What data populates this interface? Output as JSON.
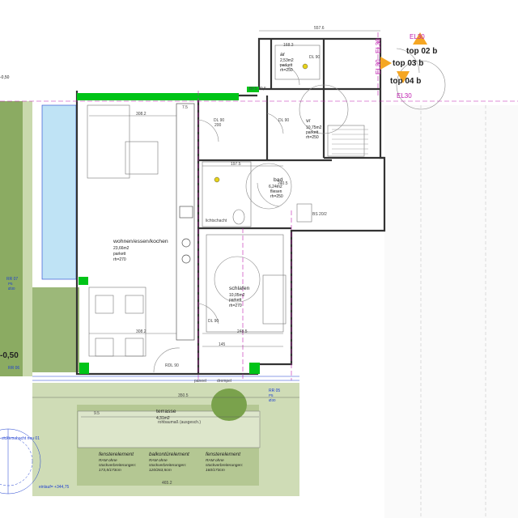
{
  "rooms": [
    {
      "name": "wohnen/essen/kochen",
      "area": "23,66m2",
      "floor": "parkett",
      "height": "rh=270"
    },
    {
      "name": "schlafen",
      "area": "10,05m2",
      "floor": "parkett",
      "height": "rh=270"
    },
    {
      "name": "bad",
      "area": "6,24m2",
      "floor": "fliesen",
      "height": "rh=250"
    },
    {
      "name": "vr",
      "area": "10,75m2",
      "floor": "parkett",
      "height": "rh=250"
    },
    {
      "name": "ar",
      "area": "2,53m2",
      "floor": "parkett",
      "height": "rh=250"
    },
    {
      "name": "terrasse",
      "area": "4,31m2",
      "floor": "",
      "height": ""
    }
  ],
  "unit_refs": [
    "top 02 b",
    "top 03 b",
    "top 04 b"
  ],
  "el_tags": [
    "EL30",
    "EL30",
    "EL30",
    "EL30"
  ],
  "level_marks": [
    "-0,50",
    "-0,50"
  ],
  "bottom_elements": [
    {
      "title": "fensterelement",
      "l1": "RAM ohne",
      "l2": "stockverbreiterungen:",
      "l3": "173,5/173cm"
    },
    {
      "title": "balkontürelement",
      "l1": "RAM ohne",
      "l2": "stockverbreiterungen:",
      "l3": "120/263,5cm"
    },
    {
      "title": "fensterelement",
      "l1": "RAM ohne",
      "l2": "stockverbreiterungen:",
      "l3": "160/173cm"
    }
  ],
  "left_notes": {
    "rr07": "RR 07",
    "rr06": "RR 06",
    "p5": "P5",
    "d30": "Ø30",
    "sickerschacht": "sickerschacht neu 01",
    "einlauf": "einlauf= +344,75"
  },
  "right_notes": {
    "rr05": "RR 05",
    "p5": "P5",
    "d30": "Ø30"
  },
  "dimensions": {
    "d557": "557.6",
    "d308a": "308.2",
    "d308b": "308.2",
    "d248": "248.5",
    "d197": "197.5",
    "d145": "145",
    "d465": "465.2",
    "d350": "350.5",
    "d380": "380.1",
    "d240": "240.5",
    "d168": "168.3",
    "d75": "7.5",
    "d95": "9.5"
  },
  "door_marks": {
    "dl1": "DL 90",
    "dl2": "DL 90",
    "dl3": "DL 90",
    "dl4": "DL 90",
    "h200": "200",
    "rdl": "RDL 90"
  },
  "labels": {
    "paneel": "paneel",
    "drempel": "drempel",
    "fbfk": "FBK",
    "lichtschacht": "lichtschacht",
    "rohbaumass": "rohbaumaß (ausgesch.)",
    "bfs": "BFS 20,5",
    "bs": "BS 20/2"
  },
  "colors": {
    "wall_green": "#00c418",
    "grass": "#8bab62",
    "grass_light": "#cfdcb6",
    "glass": "#bfe3f5",
    "accent_orange": "#f5a623",
    "tag_magenta": "#c01fb0",
    "ann_blue": "#1e3fd0"
  }
}
